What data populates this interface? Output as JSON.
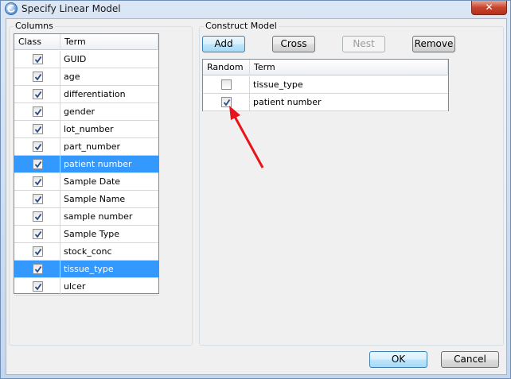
{
  "window": {
    "title": "Specify Linear Model",
    "close_icon": "close-icon"
  },
  "columns_panel": {
    "label": "Columns",
    "headers": {
      "class": "Class",
      "term": "Term"
    },
    "rows": [
      {
        "term": "GUID",
        "checked": true,
        "selected": false
      },
      {
        "term": "age",
        "checked": true,
        "selected": false
      },
      {
        "term": "differentiation",
        "checked": true,
        "selected": false
      },
      {
        "term": "gender",
        "checked": true,
        "selected": false
      },
      {
        "term": "lot_number",
        "checked": true,
        "selected": false
      },
      {
        "term": "part_number",
        "checked": true,
        "selected": false
      },
      {
        "term": "patient number",
        "checked": true,
        "selected": true
      },
      {
        "term": "Sample Date",
        "checked": true,
        "selected": false
      },
      {
        "term": "Sample Name",
        "checked": true,
        "selected": false
      },
      {
        "term": "sample number",
        "checked": true,
        "selected": false
      },
      {
        "term": "Sample Type",
        "checked": true,
        "selected": false
      },
      {
        "term": "stock_conc",
        "checked": true,
        "selected": false
      },
      {
        "term": "tissue_type",
        "checked": true,
        "selected": true
      },
      {
        "term": "ulcer",
        "checked": true,
        "selected": false
      }
    ]
  },
  "construct_panel": {
    "label": "Construct Model",
    "buttons": {
      "add": "Add",
      "cross": "Cross",
      "nest": "Nest",
      "remove": "Remove"
    },
    "headers": {
      "random": "Random",
      "term": "Term"
    },
    "rows": [
      {
        "term": "tissue_type",
        "random": false
      },
      {
        "term": "patient number",
        "random": true
      }
    ]
  },
  "footer": {
    "ok": "OK",
    "cancel": "Cancel"
  },
  "colors": {
    "selection": "#3399ff",
    "annotation_arrow": "#e8141b",
    "title_bar": "#c9d9ee"
  }
}
